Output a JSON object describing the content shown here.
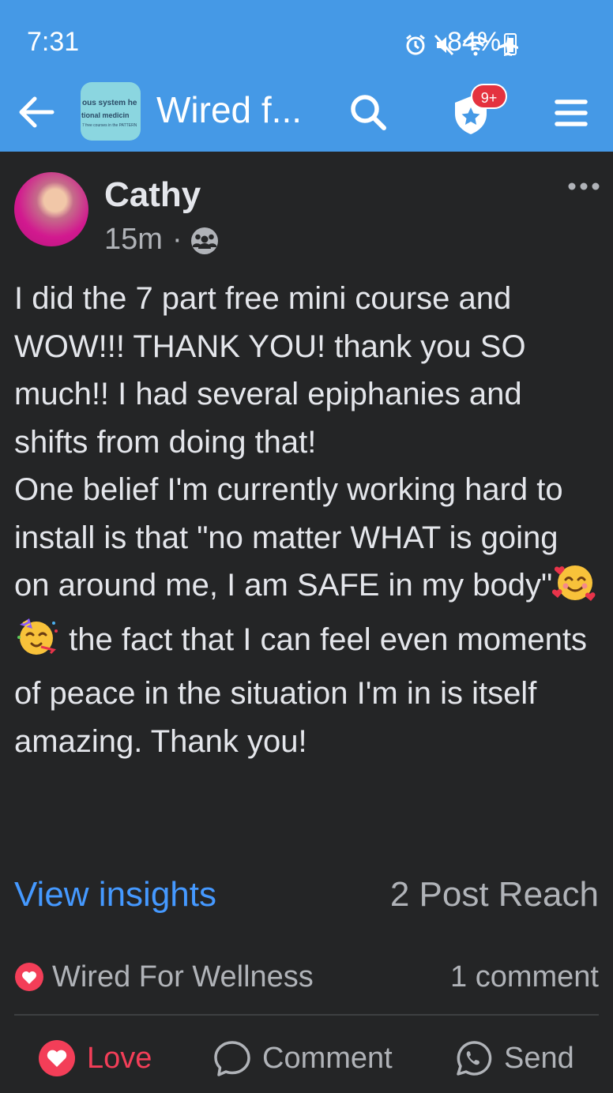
{
  "status": {
    "time": "7:31",
    "battery": "84%"
  },
  "nav": {
    "group_title": "Wired f...",
    "thumb_line1": "ous system he",
    "thumb_line2": "tional medicin",
    "thumb_line3": "7 free courses in the PATTERN",
    "notification_badge": "9+"
  },
  "post": {
    "author": "Cathy",
    "time": "15m",
    "separator": "·",
    "paragraph1": "I did the 7 part free mini course and WOW!!! THANK YOU! thank you SO much!! I had several epiphanies and shifts from doing that!",
    "paragraph2_a": "One belief I'm currently working hard to install is that \"no matter WHAT is going on around me, I am SAFE in my body\"",
    "paragraph2_b": " the fact that I can feel even moments of peace in the situation I'm in is itself amazing. Thank you!"
  },
  "insights": {
    "link": "View insights",
    "reach": "2 Post Reach"
  },
  "reactions": {
    "name": "Wired For Wellness",
    "comments": "1 comment"
  },
  "actions": {
    "love": "Love",
    "comment": "Comment",
    "send": "Send"
  },
  "colors": {
    "header": "#4599e6",
    "background": "#242526",
    "love": "#f33e58",
    "link": "#4599ff"
  }
}
